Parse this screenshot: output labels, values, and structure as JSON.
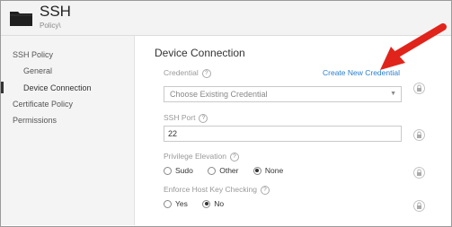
{
  "header": {
    "title": "SSH",
    "subtitle": "Policy\\"
  },
  "sidebar": {
    "items": [
      {
        "label": "SSH Policy"
      },
      {
        "label": "General"
      },
      {
        "label": "Device Connection"
      },
      {
        "label": "Certificate Policy"
      },
      {
        "label": "Permissions"
      }
    ],
    "active": "Device Connection"
  },
  "main": {
    "section_title": "Device Connection",
    "credential": {
      "label": "Credential",
      "link": "Create New Credential",
      "select_value": "Choose Existing Credential"
    },
    "ssh_port": {
      "label": "SSH Port",
      "value": "22"
    },
    "privilege_elevation": {
      "label": "Privilege Elevation",
      "options": [
        "Sudo",
        "Other",
        "None"
      ],
      "selected": "None"
    },
    "host_key_checking": {
      "label": "Enforce Host Key Checking",
      "options": [
        "Yes",
        "No"
      ],
      "selected": "No"
    }
  },
  "icons": {
    "help": "?",
    "select_arrow": "▼"
  },
  "colors": {
    "link": "#2a7fcf",
    "annotation_arrow": "#e0241b"
  }
}
